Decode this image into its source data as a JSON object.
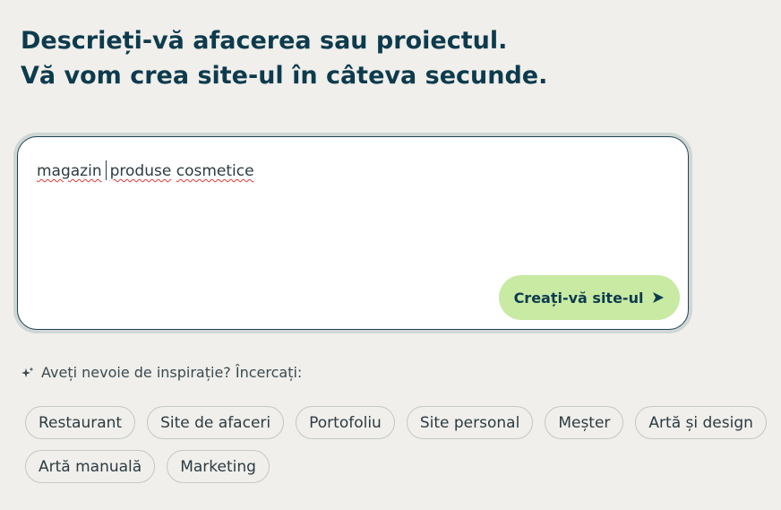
{
  "headline": {
    "line1": "Descrieți-vă afacerea sau proiectul.",
    "line2": "Vă vom crea site-ul în câteva secunde."
  },
  "prompt": {
    "value_part1": "magazin",
    "value_part2": "produse",
    "value_part3": "cosmetice"
  },
  "create_button": {
    "label": "Creați-vă site-ul",
    "icon": "send-arrow-icon"
  },
  "inspiration": {
    "icon": "sparkle-icon",
    "text": "Aveți nevoie de inspirație? Încercați:"
  },
  "suggestions": [
    "Restaurant",
    "Site de afaceri",
    "Portofoliu",
    "Site personal",
    "Meșter",
    "Artă și design",
    "Artă manuală",
    "Marketing"
  ],
  "colors": {
    "background": "#f0efeb",
    "heading": "#0d3b4d",
    "button_bg": "#c8eaa3",
    "spellcheck": "#e0393a"
  }
}
